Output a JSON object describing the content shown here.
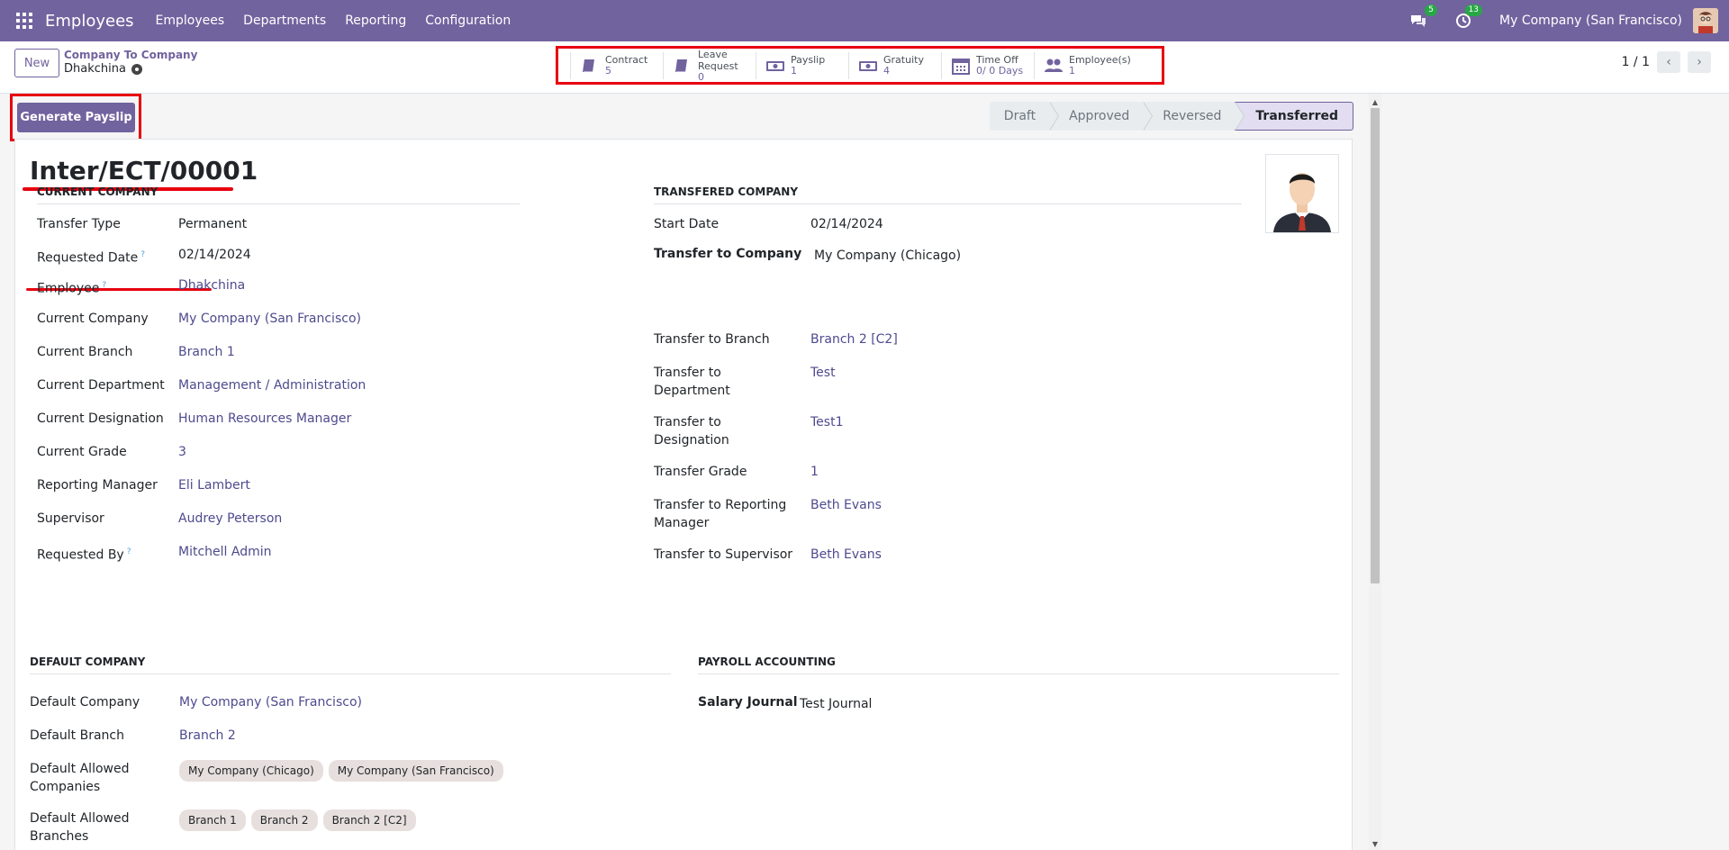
{
  "navbar": {
    "brand": "Employees",
    "menus": [
      "Employees",
      "Departments",
      "Reporting",
      "Configuration"
    ],
    "messages_count": "5",
    "activities_count": "13",
    "company": "My Company (San Francisco)"
  },
  "control_panel": {
    "new_label": "New",
    "breadcrumb_parent": "Company To Company",
    "breadcrumb_current": "Dhakchina",
    "pager": "1 / 1"
  },
  "smart_buttons": [
    {
      "label": "Contract",
      "value": "5",
      "icon": "book-icon"
    },
    {
      "label": "Leave Request",
      "value": "0",
      "icon": "book-icon"
    },
    {
      "label": "Payslip",
      "value": "1",
      "icon": "money-icon"
    },
    {
      "label": "Gratuity",
      "value": "4",
      "icon": "money-icon"
    },
    {
      "label": "Time Off",
      "value": "0/ 0 Days",
      "icon": "calendar-icon"
    },
    {
      "label": "Employee(s)",
      "value": "1",
      "icon": "users-icon"
    }
  ],
  "actions": {
    "generate_payslip": "Generate Payslip"
  },
  "stages": [
    "Draft",
    "Approved",
    "Reversed",
    "Transferred"
  ],
  "record": {
    "title": "Inter/ECT/00001"
  },
  "current_company": {
    "section": "CURRENT COMPANY",
    "fields": [
      {
        "label": "Transfer Type",
        "value": "Permanent"
      },
      {
        "label": "Requested Date",
        "value": "02/14/2024",
        "help": "?"
      },
      {
        "label": "Employee",
        "value": "Dhakchina",
        "help": "?"
      },
      {
        "label": "Current Company",
        "value": "My Company (San Francisco)"
      },
      {
        "label": "Current Branch",
        "value": "Branch 1"
      },
      {
        "label": "Current Department",
        "value": "Management / Administration"
      },
      {
        "label": "Current Designation",
        "value": "Human Resources Manager"
      },
      {
        "label": "Current Grade",
        "value": "3"
      },
      {
        "label": "Reporting Manager",
        "value": "Eli Lambert"
      },
      {
        "label": "Supervisor",
        "value": "Audrey Peterson"
      },
      {
        "label": "Requested By",
        "value": "Mitchell Admin",
        "help": "?"
      }
    ]
  },
  "transfered_company": {
    "section": "TRANSFERED COMPANY",
    "fields": [
      {
        "label": "Start Date",
        "value": "02/14/2024"
      },
      {
        "label": "Transfer to Company",
        "value": "My Company (Chicago)"
      },
      {
        "label": "Transfer to Branch",
        "value": "Branch 2 [C2]"
      },
      {
        "label": "Transfer to Department",
        "value": "Test"
      },
      {
        "label": "Transfer to Designation",
        "value": "Test1"
      },
      {
        "label": "Transfer Grade",
        "value": "1"
      },
      {
        "label": "Transfer to Reporting Manager",
        "value": "Beth Evans"
      },
      {
        "label": "Transfer to Supervisor",
        "value": "Beth Evans"
      }
    ]
  },
  "default_company": {
    "section": "DEFAULT COMPANY",
    "fields": [
      {
        "label": "Default Company",
        "value": "My Company (San Francisco)"
      },
      {
        "label": "Default Branch",
        "value": "Branch 2"
      },
      {
        "label": "Default Allowed Companies",
        "tags": [
          "My Company (Chicago)",
          "My Company (San Francisco)"
        ]
      },
      {
        "label": "Default Allowed Branches",
        "tags": [
          "Branch 1",
          "Branch 2",
          "Branch 2 [C2]"
        ]
      }
    ]
  },
  "payroll_accounting": {
    "section": "PAYROLL ACCOUNTING",
    "fields": [
      {
        "label": "Salary Journal",
        "value": "Test Journal"
      }
    ]
  },
  "colors": {
    "brand": "#71639e",
    "highlight": "#e8000e",
    "link": "#4e4a8e"
  }
}
